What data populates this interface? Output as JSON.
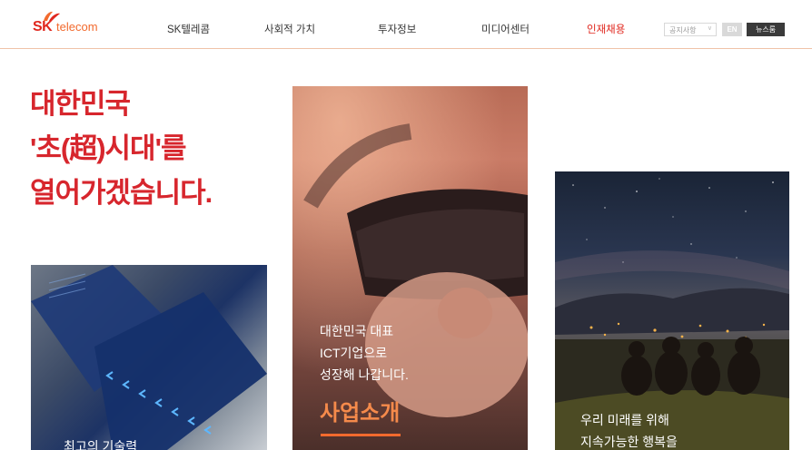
{
  "header": {
    "logo": {
      "sk": "SK",
      "telecom": "telecom"
    },
    "nav": [
      {
        "label": "SK텔레콤"
      },
      {
        "label": "사회적 가치"
      },
      {
        "label": "투자정보"
      },
      {
        "label": "미디어센터"
      },
      {
        "label": "인재채용",
        "active": true
      }
    ],
    "utility": {
      "notice_select": "공지사항",
      "lang_button": "EN",
      "newsroom_button": "뉴스룸"
    }
  },
  "hero": {
    "headline_lines": [
      "대한민국",
      "'초(超)시대'를",
      "열어가겠습니다."
    ]
  },
  "cards": [
    {
      "text_lines": [
        "최고의 기술력"
      ]
    },
    {
      "text_lines": [
        "대한민국 대표",
        "ICT기업으로",
        "성장해 나갑니다."
      ],
      "title": "사업소개"
    },
    {
      "text_lines": [
        "우리 미래를 위해",
        "지속가능한 행복을"
      ]
    }
  ],
  "colors": {
    "brand_red": "#e0271e",
    "brand_orange": "#f26a2e"
  }
}
